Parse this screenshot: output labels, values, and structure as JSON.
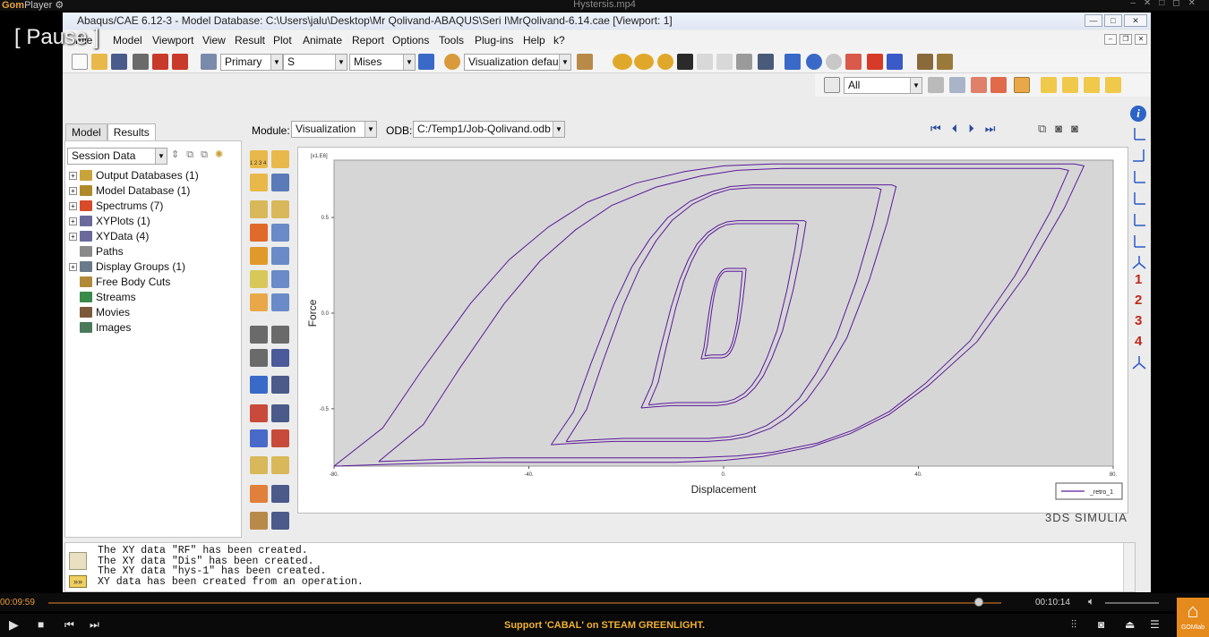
{
  "player": {
    "brand_a": "Gom",
    "brand_b": "Player",
    "file_title": "Hystersis.mp4",
    "pause_label": "[ Pause ]",
    "time_current": "00:09:59",
    "time_total": "00:10:14",
    "progress": 0.976,
    "promo": "Support 'CABAL' on STEAM GREENLIGHT.",
    "gomlab_label": "GOMlab",
    "accent_color": "#e8a23a"
  },
  "window": {
    "title": "Abaqus/CAE 6.12-3 - Model Database: C:\\Users\\jalu\\Desktop\\Mr Qolivand-ABAQUS\\Seri I\\MrQolivand-6.14.cae [Viewport: 1]"
  },
  "menu": [
    "File",
    "Model",
    "Viewport",
    "View",
    "Result",
    "Plot",
    "Animate",
    "Report",
    "Options",
    "Tools",
    "Plug-ins",
    "Help",
    "k?"
  ],
  "toolbar": {
    "primary": "Primary",
    "variable": "S",
    "invariant": "Mises",
    "vis_defaults": "Visualization defaults",
    "select_all": "All",
    "step_label": "1 2 3 4"
  },
  "tree": {
    "tabs": [
      "Model",
      "Results"
    ],
    "session_select": "Session Data",
    "items": [
      {
        "label": "Output Databases (1)",
        "expand": "+",
        "color": "#c9a43a"
      },
      {
        "label": "Model Database (1)",
        "expand": "+",
        "color": "#b08a2a"
      },
      {
        "label": "Spectrums (7)",
        "expand": "+",
        "color": "#d84a2a"
      },
      {
        "label": "XYPlots (1)",
        "expand": "+",
        "color": "#6a6a9a"
      },
      {
        "label": "XYData (4)",
        "expand": "+",
        "color": "#6a6a9a"
      },
      {
        "label": "Paths",
        "expand": "",
        "color": "#8a8a8a"
      },
      {
        "label": "Display Groups (1)",
        "expand": "+",
        "color": "#6a7a8a"
      },
      {
        "label": "Free Body Cuts",
        "expand": "",
        "color": "#b08a3a"
      },
      {
        "label": "Streams",
        "expand": "",
        "color": "#3a8a4a"
      },
      {
        "label": "Movies",
        "expand": "",
        "color": "#7a5a3a"
      },
      {
        "label": "Images",
        "expand": "",
        "color": "#4a7a5a"
      }
    ]
  },
  "module_bar": {
    "module_label": "Module:",
    "module_value": "Visualization",
    "odb_label": "ODB:",
    "odb_value": "C:/Temp1/Job-Qolivand.odb"
  },
  "right_strip": {
    "numbers": [
      "1",
      "2",
      "3",
      "4"
    ]
  },
  "brand": "3DS SIMULIA",
  "messages": [
    "The XY data \"RF\" has been created.",
    "The XY data \"Dis\" has been created.",
    "The XY data \"hys-1\" has been created.",
    "XY data has been created from an operation."
  ],
  "chart_data": {
    "type": "line",
    "xlabel": "Displacement",
    "ylabel": "Force",
    "xlim": [
      -80,
      80
    ],
    "ylim": [
      -0.8,
      0.8
    ],
    "y_multiplier": "[x1.E6]",
    "xticks": [
      "-80.",
      "-40.",
      "0.",
      "40.",
      "80."
    ],
    "yticks": [
      "0.5",
      "0.0",
      "-0.5"
    ],
    "ytick_values": [
      0.5,
      0.0,
      -0.5
    ],
    "legend": [
      "_retro_1"
    ],
    "line_color": "#5a1a9a",
    "series": [
      {
        "name": "_retro_1",
        "x": [
          -80,
          -70,
          -62,
          -52,
          -44,
          -36,
          -28,
          -18,
          -8,
          0,
          10,
          22,
          36,
          50,
          64,
          72,
          74,
          70,
          62,
          52,
          42,
          34,
          26,
          18,
          8,
          0,
          -10,
          -22,
          -36,
          -52,
          -68,
          -80
        ],
        "y": [
          -0.8,
          -0.6,
          -0.3,
          0.05,
          0.28,
          0.45,
          0.58,
          0.68,
          0.74,
          0.77,
          0.78,
          0.78,
          0.78,
          0.78,
          0.78,
          0.78,
          0.77,
          0.55,
          0.2,
          -0.15,
          -0.38,
          -0.53,
          -0.63,
          -0.7,
          -0.75,
          -0.77,
          -0.78,
          -0.78,
          -0.78,
          -0.78,
          -0.79,
          -0.8
        ]
      }
    ]
  }
}
